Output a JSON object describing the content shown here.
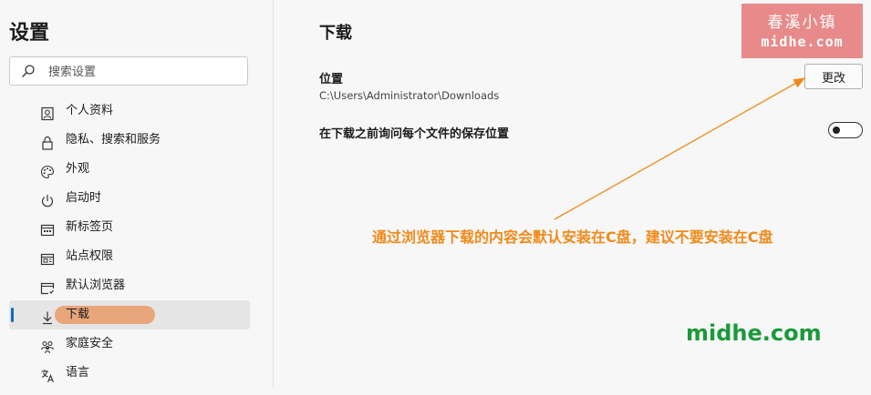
{
  "sidebar": {
    "title": "设置",
    "search_placeholder": "搜索设置",
    "items": [
      {
        "label": "个人资料",
        "icon": "profile-icon"
      },
      {
        "label": "隐私、搜索和服务",
        "icon": "lock-icon"
      },
      {
        "label": "外观",
        "icon": "palette-icon"
      },
      {
        "label": "启动时",
        "icon": "power-icon"
      },
      {
        "label": "新标签页",
        "icon": "new-tab-icon"
      },
      {
        "label": "站点权限",
        "icon": "site-permissions-icon"
      },
      {
        "label": "默认浏览器",
        "icon": "default-browser-icon"
      },
      {
        "label": "下载",
        "icon": "download-icon",
        "active": true
      },
      {
        "label": "家庭安全",
        "icon": "family-icon"
      },
      {
        "label": "语言",
        "icon": "language-icon"
      }
    ]
  },
  "main": {
    "title": "下载",
    "location_label": "位置",
    "location_path": "C:\\Users\\Administrator\\Downloads",
    "change_button": "更改",
    "ask_label": "在下载之前询问每个文件的保存位置",
    "ask_toggle_on": false
  },
  "overlay": {
    "watermark_top": "春溪小镇",
    "watermark_bottom": "midhe.com",
    "annotation": "通过浏览器下载的内容会默认安装在C盘，建议不要安装在C盘",
    "brand": "midhe.com"
  },
  "colors": {
    "accent": "#0f6cbd",
    "highlight": "#e8a67a",
    "annotation": "#f08a1a",
    "brand": "#1a9a3a",
    "watermark_bg": "#e88a8a"
  }
}
